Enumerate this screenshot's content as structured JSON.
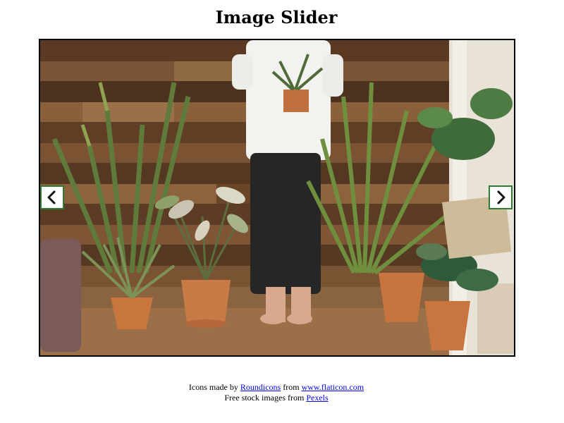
{
  "page": {
    "title": "Image Slider"
  },
  "slider": {
    "prev_icon": "chevron-left-icon",
    "next_icon": "chevron-right-icon",
    "accent_color": "#2e7d32",
    "slide_image": "photo of person holding potted plant surrounded by houseplants against wooden wall"
  },
  "credits": {
    "line1_prefix": "Icons made by ",
    "line1_link1": "Roundicons",
    "line1_middle": " from ",
    "line1_link2": "www.flaticon.com",
    "line2_prefix": "Free stock images from ",
    "line2_link": "Pexels"
  }
}
